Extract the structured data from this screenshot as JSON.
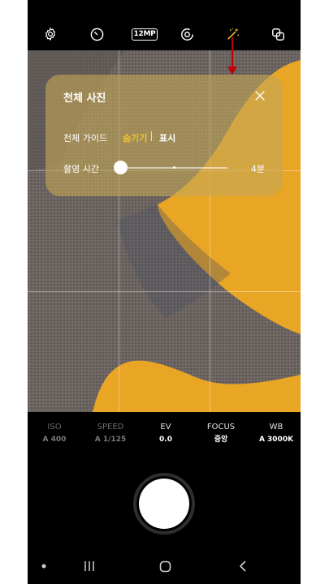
{
  "topbar": {
    "icons": [
      "gear-icon",
      "timer-icon",
      "resolution-badge",
      "motion-photo-icon",
      "effects-sparkle-icon",
      "mode-switch-icon"
    ],
    "resolution_label": "12MP",
    "active_color": "#f4c22a"
  },
  "panel": {
    "title": "천체 사진",
    "guide_label": "천체 가이드",
    "guide_hide": "숨기기",
    "guide_show": "표시",
    "time_label": "촬영 시간",
    "time_value": "4분",
    "time_slider_fraction": 0.0
  },
  "pro_settings": [
    {
      "name": "ISO",
      "value": "A 400",
      "active": false
    },
    {
      "name": "SPEED",
      "value": "A 1/125",
      "active": false
    },
    {
      "name": "EV",
      "value": "0.0",
      "active": true
    },
    {
      "name": "FOCUS",
      "value": "중앙",
      "active": true
    },
    {
      "name": "WB",
      "value": "A 3000K",
      "active": true
    }
  ],
  "colors": {
    "viewfinder_yellow": "#e9a524",
    "fabric_gray": "#6b6461",
    "annotation_red": "#c00000"
  },
  "navbar": {
    "icons": [
      "dot-icon",
      "recent-apps-icon",
      "home-icon",
      "back-icon"
    ]
  }
}
